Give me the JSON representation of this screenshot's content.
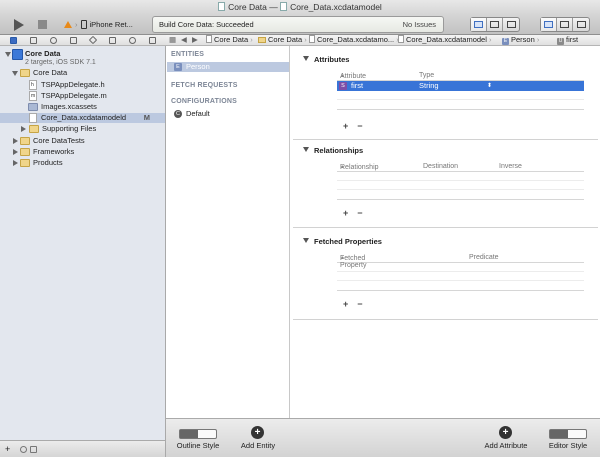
{
  "window": {
    "title": "Core Data",
    "title_sep": "—",
    "document": "Core_Data.xcdatamodel"
  },
  "toolbar": {
    "scheme_target": "iPhone Ret...",
    "activity_status": "Build Core Data: Succeeded",
    "issues": "No Issues"
  },
  "navigator": {
    "items": [
      {
        "label": "Core Data",
        "sub": "2 targets, iOS SDK 7.1"
      },
      {
        "label": "Core Data"
      },
      {
        "label": "TSPAppDelegate.h",
        "file_letter": "h"
      },
      {
        "label": "TSPAppDelegate.m",
        "file_letter": "m"
      },
      {
        "label": "Images.xcassets"
      },
      {
        "label": "Core_Data.xcdatamodeld",
        "badge": "M"
      },
      {
        "label": "Supporting Files"
      },
      {
        "label": "Core DataTests"
      },
      {
        "label": "Frameworks"
      },
      {
        "label": "Products"
      }
    ]
  },
  "jumpbar": {
    "crumbs": [
      "Core Data",
      "Core Data",
      "Core_Data.xcdatamo...",
      "Core_Data.xcdatamodel",
      "Person",
      "first"
    ],
    "first_badge": "U"
  },
  "outline": {
    "entities_header": "ENTITIES",
    "entity": "Person",
    "entity_badge": "E",
    "fetch_header": "FETCH REQUESTS",
    "config_header": "CONFIGURATIONS",
    "config_item": "Default",
    "config_badge": "C"
  },
  "editor": {
    "attributes": {
      "title": "Attributes",
      "col_attribute": "Attribute",
      "col_type": "Type",
      "row": {
        "badge": "S",
        "name": "first",
        "type": "String"
      }
    },
    "relationships": {
      "title": "Relationships",
      "col_relationship": "Relationship",
      "col_destination": "Destination",
      "col_inverse": "Inverse"
    },
    "fetched": {
      "title": "Fetched Properties",
      "col_property": "Fetched Property",
      "col_predicate": "Predicate"
    },
    "plus": "+",
    "minus": "−"
  },
  "bottombar": {
    "outline_style": "Outline Style",
    "add_entity": "Add Entity",
    "add_attribute": "Add Attribute",
    "editor_style": "Editor Style",
    "plus": "+"
  }
}
